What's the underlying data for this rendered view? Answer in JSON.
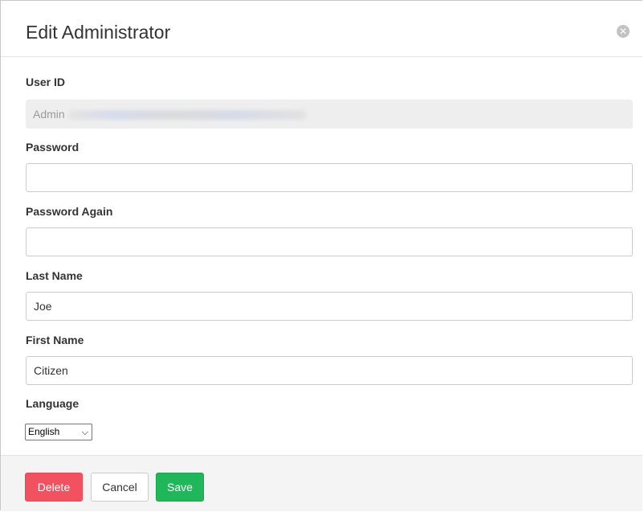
{
  "dialog": {
    "title": "Edit Administrator",
    "close_icon": "close-circle-icon"
  },
  "fields": {
    "user_id": {
      "label": "User ID",
      "value_prefix": "Admin"
    },
    "password": {
      "label": "Password",
      "value": ""
    },
    "password_again": {
      "label": "Password Again",
      "value": ""
    },
    "last_name": {
      "label": "Last Name",
      "value": "Joe"
    },
    "first_name": {
      "label": "First Name",
      "value": "Citizen"
    },
    "language": {
      "label": "Language",
      "selected": "English"
    }
  },
  "footer": {
    "delete_label": "Delete",
    "cancel_label": "Cancel",
    "save_label": "Save"
  },
  "colors": {
    "delete": "#f2525f",
    "save": "#1fb75a",
    "footer_bg": "#f4f4f4"
  }
}
